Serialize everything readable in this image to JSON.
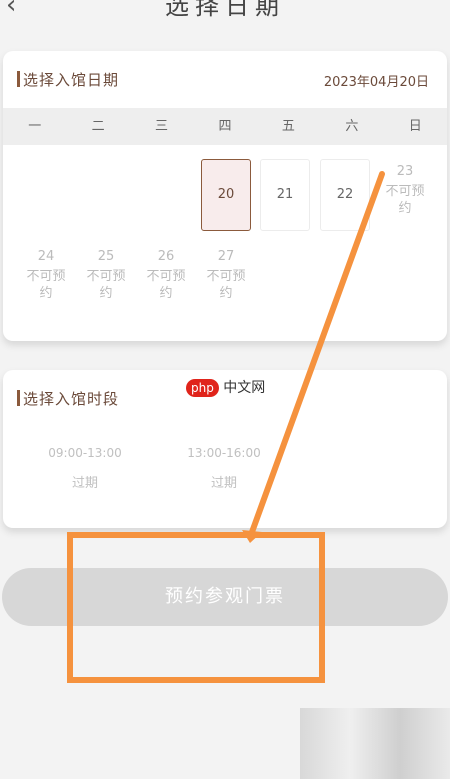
{
  "header": {
    "back_icon": "‹",
    "title": "选择日期"
  },
  "date_section": {
    "heading": "选择入馆日期",
    "selected_date": "2023年04月20日",
    "weekdays": [
      "一",
      "二",
      "三",
      "四",
      "五",
      "六",
      "日"
    ],
    "days": [
      {
        "day": "20",
        "status": "selected"
      },
      {
        "day": "21",
        "status": "available"
      },
      {
        "day": "22",
        "status": "available"
      },
      {
        "day": "23",
        "status": "unavailable",
        "note": "不可预约"
      },
      {
        "day": "24",
        "status": "unavailable",
        "note": "不可预约"
      },
      {
        "day": "25",
        "status": "unavailable",
        "note": "不可预约"
      },
      {
        "day": "26",
        "status": "unavailable",
        "note": "不可预约"
      },
      {
        "day": "27",
        "status": "unavailable",
        "note": "不可预约"
      }
    ]
  },
  "time_section": {
    "heading": "选择入馆时段",
    "slots": [
      {
        "time": "09:00-13:00",
        "status": "过期"
      },
      {
        "time": "13:00-16:00",
        "status": "过期"
      }
    ]
  },
  "book_button": {
    "label": "预约参观门票"
  },
  "watermark": {
    "logo": "php",
    "text": "中文网"
  },
  "colors": {
    "accent": "#8b5a3c",
    "annotation": "#f5923e",
    "button_disabled": "#d7d7d7"
  }
}
